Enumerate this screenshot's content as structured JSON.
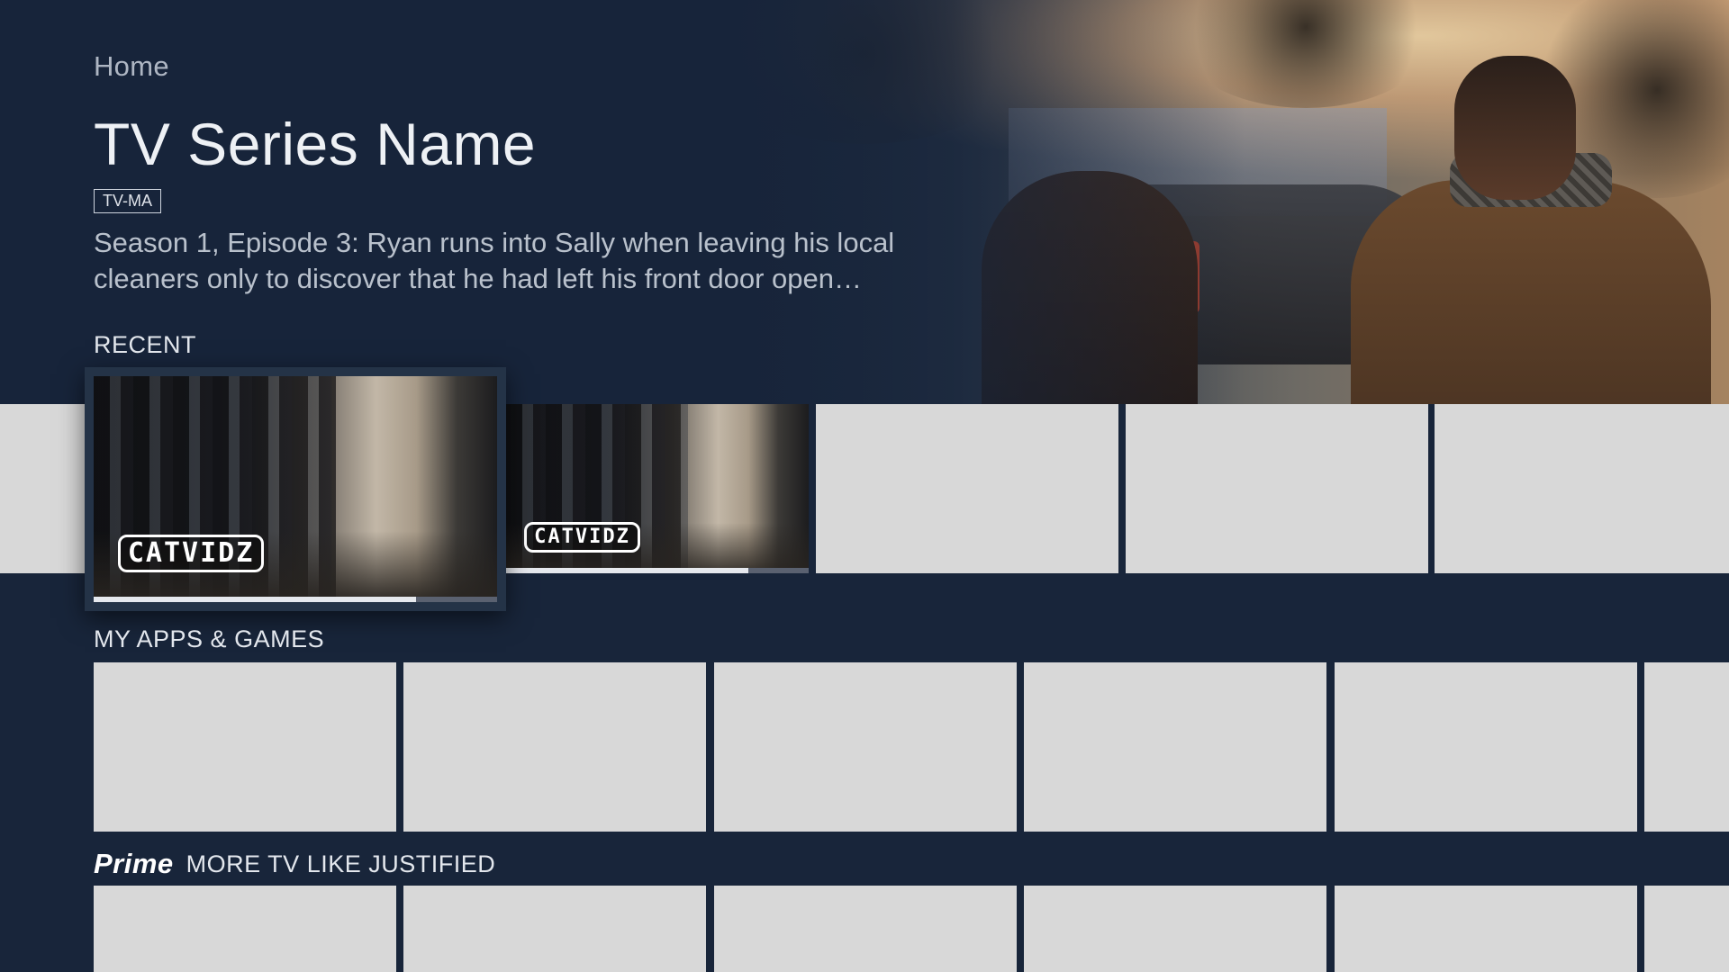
{
  "header": {
    "breadcrumb": "Home",
    "title": "TV Series Name",
    "rating": "TV-MA",
    "description": "Season 1, Episode 3: Ryan runs into Sally when leaving his local cleaners only to discover that he had left his front door open…"
  },
  "sections": {
    "recent": {
      "label": "RECENT"
    },
    "apps": {
      "label": "MY APPS & GAMES"
    },
    "prime": {
      "logo": "Prime",
      "label": "MORE TV LIKE JUSTIFIED"
    }
  },
  "recent_items": [
    {
      "name": "CATVIDZ",
      "logo_text": "CATVIDZ",
      "progress": 0.8,
      "focused": true
    },
    {
      "name": "CATVIDZ",
      "logo_text": "CATVIDZ",
      "progress": 0.8,
      "focused": false
    }
  ],
  "colors": {
    "background": "#18253a",
    "tile_placeholder": "#d8d8d8",
    "focus_frame": "#243347"
  }
}
